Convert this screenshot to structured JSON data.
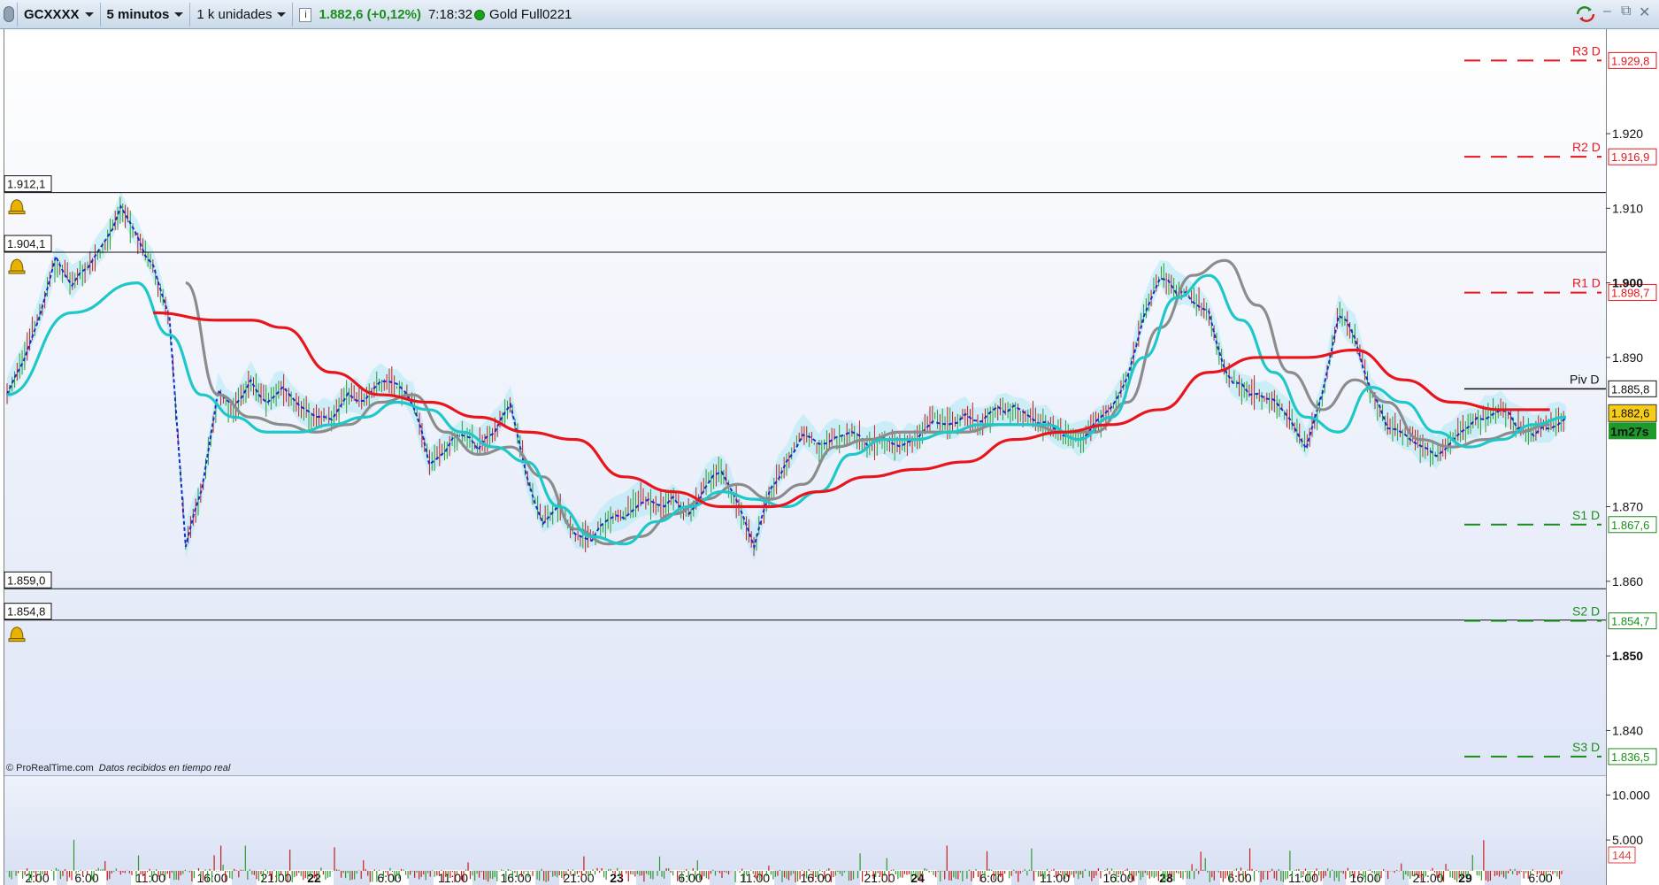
{
  "toolbar": {
    "symbol": "GCXXXX",
    "timeframe": "5 minutos",
    "units": "1 k unidades",
    "price": "1.882,6 (+0,12%)",
    "time": "7:18:32",
    "instrument": "Gold Full0221",
    "info_glyph": "i",
    "minimize": "–",
    "restore": "⧉",
    "close": "✕"
  },
  "colors": {
    "accent_up": "#1d8f1d",
    "ma_long": "#e8161c",
    "ma_short": "#1fc8c8",
    "ma_slow": "#8c8c8c",
    "cloud": "#aeeaf5",
    "resistance": "#e8161c",
    "support": "#189018"
  },
  "chart": {
    "copyright": "© ProRealTime.com",
    "feed_note": "Datos recibidos en tiempo real",
    "timer": "1m27s",
    "last_price_label": "1.882,6",
    "piv_value": "1.885,8",
    "y_ticks": [
      {
        "label": "1.920",
        "v": 1920
      },
      {
        "label": "1.910",
        "v": 1910
      },
      {
        "label": "1.900",
        "v": 1900
      },
      {
        "label": "1.890",
        "v": 1890
      },
      {
        "label": "1.870",
        "v": 1870
      },
      {
        "label": "1.860",
        "v": 1860
      },
      {
        "label": "1.850",
        "v": 1850
      },
      {
        "label": "1.840",
        "v": 1840
      }
    ],
    "price_range": [
      1834,
      1934
    ],
    "pivots": [
      {
        "name": "R3 D",
        "value": 1929.8,
        "label": "1.929,8",
        "kind": "res"
      },
      {
        "name": "R2 D",
        "value": 1916.9,
        "label": "1.916,9",
        "kind": "res"
      },
      {
        "name": "R1 D",
        "value": 1898.7,
        "label": "1.898,7",
        "kind": "res"
      },
      {
        "name": "S1 D",
        "value": 1867.6,
        "label": "1.867,6",
        "kind": "sup"
      },
      {
        "name": "S2 D",
        "value": 1854.7,
        "label": "1.854,7",
        "kind": "sup"
      },
      {
        "name": "S3 D",
        "value": 1836.5,
        "label": "1.836,5",
        "kind": "sup"
      }
    ],
    "pivot_point": {
      "name": "Piv D",
      "value": 1885.8
    },
    "alerts": [
      {
        "label": "1.912,1",
        "value": 1912.1
      },
      {
        "label": "1.904,1",
        "value": 1904.1
      },
      {
        "label": "1.859,0",
        "value": 1859.0
      },
      {
        "label": "1.854,8",
        "value": 1854.8
      }
    ],
    "volume_ticks": [
      {
        "label": "10.000",
        "v": 10000
      },
      {
        "label": "5.000",
        "v": 5000
      }
    ],
    "volume_last": "144",
    "x_ticks": [
      {
        "label": "2:00",
        "bold": false
      },
      {
        "label": "6:00",
        "bold": false
      },
      {
        "label": "11:00",
        "bold": false
      },
      {
        "label": "16:00",
        "bold": false
      },
      {
        "label": "21:00",
        "bold": false
      },
      {
        "label": "22",
        "bold": true
      },
      {
        "label": "6:00",
        "bold": false
      },
      {
        "label": "11:00",
        "bold": false
      },
      {
        "label": "16:00",
        "bold": false
      },
      {
        "label": "21:00",
        "bold": false
      },
      {
        "label": "23",
        "bold": true
      },
      {
        "label": "6:00",
        "bold": false
      },
      {
        "label": "11:00",
        "bold": false
      },
      {
        "label": "16:00",
        "bold": false
      },
      {
        "label": "21:00",
        "bold": false
      },
      {
        "label": "24",
        "bold": true
      },
      {
        "label": "6:00",
        "bold": false
      },
      {
        "label": "11:00",
        "bold": false
      },
      {
        "label": "16:00",
        "bold": false
      },
      {
        "label": "28",
        "bold": true
      },
      {
        "label": "6:00",
        "bold": false
      },
      {
        "label": "11:00",
        "bold": false
      },
      {
        "label": "16:00",
        "bold": false
      },
      {
        "label": "21:00",
        "bold": false
      },
      {
        "label": "29",
        "bold": true
      },
      {
        "label": "6:00",
        "bold": false
      }
    ],
    "price_path": [
      [
        0,
        1885
      ],
      [
        1,
        1890
      ],
      [
        2,
        1896
      ],
      [
        3,
        1903
      ],
      [
        4,
        1900
      ],
      [
        5,
        1902
      ],
      [
        6,
        1905
      ],
      [
        7,
        1910
      ],
      [
        8,
        1906
      ],
      [
        9,
        1902
      ],
      [
        10,
        1895
      ],
      [
        11,
        1865
      ],
      [
        12,
        1872
      ],
      [
        13,
        1885
      ],
      [
        14,
        1883
      ],
      [
        15,
        1887
      ],
      [
        16,
        1884
      ],
      [
        17,
        1886
      ],
      [
        18,
        1883
      ],
      [
        19,
        1882
      ],
      [
        20,
        1882
      ],
      [
        21,
        1885
      ],
      [
        22,
        1884
      ],
      [
        23,
        1887
      ],
      [
        24,
        1886
      ],
      [
        25,
        1884
      ],
      [
        26,
        1876
      ],
      [
        27,
        1878
      ],
      [
        28,
        1880
      ],
      [
        29,
        1878
      ],
      [
        30,
        1880
      ],
      [
        31,
        1884
      ],
      [
        32,
        1874
      ],
      [
        33,
        1868
      ],
      [
        34,
        1870
      ],
      [
        35,
        1866
      ],
      [
        36,
        1866
      ],
      [
        37,
        1868
      ],
      [
        38,
        1869
      ],
      [
        39,
        1871
      ],
      [
        40,
        1870
      ],
      [
        41,
        1871
      ],
      [
        42,
        1869
      ],
      [
        43,
        1873
      ],
      [
        44,
        1875
      ],
      [
        45,
        1870
      ],
      [
        46,
        1865
      ],
      [
        47,
        1872
      ],
      [
        48,
        1876
      ],
      [
        49,
        1880
      ],
      [
        50,
        1878
      ],
      [
        51,
        1879
      ],
      [
        52,
        1880
      ],
      [
        53,
        1878
      ],
      [
        54,
        1879
      ],
      [
        55,
        1878
      ],
      [
        56,
        1879
      ],
      [
        57,
        1882
      ],
      [
        58,
        1881
      ],
      [
        59,
        1882
      ],
      [
        60,
        1881
      ],
      [
        61,
        1883
      ],
      [
        62,
        1883
      ],
      [
        63,
        1882
      ],
      [
        64,
        1881
      ],
      [
        65,
        1880
      ],
      [
        66,
        1879
      ],
      [
        67,
        1881
      ],
      [
        68,
        1883
      ],
      [
        69,
        1887
      ],
      [
        70,
        1896
      ],
      [
        71,
        1901
      ],
      [
        72,
        1899
      ],
      [
        73,
        1898
      ],
      [
        74,
        1896
      ],
      [
        75,
        1888
      ],
      [
        76,
        1886
      ],
      [
        77,
        1885
      ],
      [
        78,
        1884
      ],
      [
        79,
        1882
      ],
      [
        80,
        1878
      ],
      [
        81,
        1885
      ],
      [
        82,
        1896
      ],
      [
        83,
        1893
      ],
      [
        84,
        1885
      ],
      [
        85,
        1881
      ],
      [
        86,
        1880
      ],
      [
        87,
        1878
      ],
      [
        88,
        1877
      ],
      [
        89,
        1879
      ],
      [
        90,
        1881
      ],
      [
        91,
        1882
      ],
      [
        92,
        1883
      ],
      [
        93,
        1881
      ],
      [
        94,
        1880
      ],
      [
        95,
        1881
      ],
      [
        96,
        1882
      ]
    ],
    "ma_short": [
      [
        0,
        1885
      ],
      [
        4,
        1896
      ],
      [
        8,
        1900
      ],
      [
        10,
        1893
      ],
      [
        12,
        1885
      ],
      [
        14,
        1882
      ],
      [
        16,
        1880
      ],
      [
        18,
        1880
      ],
      [
        20,
        1881
      ],
      [
        22,
        1882
      ],
      [
        24,
        1884
      ],
      [
        26,
        1883
      ],
      [
        28,
        1880
      ],
      [
        30,
        1878
      ],
      [
        32,
        1876
      ],
      [
        34,
        1870
      ],
      [
        36,
        1866
      ],
      [
        38,
        1865
      ],
      [
        40,
        1868
      ],
      [
        42,
        1870
      ],
      [
        44,
        1872
      ],
      [
        46,
        1871
      ],
      [
        48,
        1870
      ],
      [
        50,
        1872
      ],
      [
        52,
        1877
      ],
      [
        54,
        1879
      ],
      [
        56,
        1879
      ],
      [
        58,
        1880
      ],
      [
        60,
        1881
      ],
      [
        62,
        1881
      ],
      [
        64,
        1881
      ],
      [
        66,
        1879
      ],
      [
        68,
        1882
      ],
      [
        70,
        1890
      ],
      [
        72,
        1898
      ],
      [
        74,
        1901
      ],
      [
        76,
        1895
      ],
      [
        78,
        1888
      ],
      [
        80,
        1882
      ],
      [
        82,
        1880
      ],
      [
        84,
        1886
      ],
      [
        86,
        1884
      ],
      [
        88,
        1880
      ],
      [
        90,
        1878
      ],
      [
        92,
        1879
      ],
      [
        94,
        1881
      ],
      [
        96,
        1882
      ]
    ],
    "ma_slow": [
      [
        11,
        1900
      ],
      [
        13,
        1885
      ],
      [
        15,
        1882
      ],
      [
        17,
        1881
      ],
      [
        19,
        1880
      ],
      [
        21,
        1881
      ],
      [
        23,
        1884
      ],
      [
        25,
        1885
      ],
      [
        27,
        1880
      ],
      [
        29,
        1877
      ],
      [
        31,
        1878
      ],
      [
        33,
        1874
      ],
      [
        35,
        1867
      ],
      [
        37,
        1865
      ],
      [
        39,
        1866
      ],
      [
        41,
        1869
      ],
      [
        43,
        1871
      ],
      [
        45,
        1873
      ],
      [
        47,
        1871
      ],
      [
        49,
        1873
      ],
      [
        51,
        1878
      ],
      [
        53,
        1879
      ],
      [
        55,
        1880
      ],
      [
        57,
        1880
      ],
      [
        59,
        1880
      ],
      [
        61,
        1881
      ],
      [
        63,
        1881
      ],
      [
        65,
        1880
      ],
      [
        67,
        1880
      ],
      [
        69,
        1884
      ],
      [
        71,
        1894
      ],
      [
        73,
        1901
      ],
      [
        75,
        1903
      ],
      [
        77,
        1897
      ],
      [
        79,
        1888
      ],
      [
        81,
        1883
      ],
      [
        83,
        1887
      ],
      [
        85,
        1884
      ],
      [
        87,
        1879
      ],
      [
        89,
        1878
      ],
      [
        91,
        1879
      ],
      [
        93,
        1880
      ],
      [
        95,
        1881
      ]
    ],
    "ma_long": [
      [
        9,
        1896
      ],
      [
        13,
        1895
      ],
      [
        15,
        1895
      ],
      [
        17,
        1894
      ],
      [
        20,
        1888
      ],
      [
        23,
        1885
      ],
      [
        26,
        1884
      ],
      [
        29,
        1882
      ],
      [
        32,
        1880
      ],
      [
        35,
        1879
      ],
      [
        38,
        1874
      ],
      [
        41,
        1872
      ],
      [
        44,
        1870
      ],
      [
        47,
        1870
      ],
      [
        50,
        1872
      ],
      [
        53,
        1874
      ],
      [
        56,
        1875
      ],
      [
        59,
        1876
      ],
      [
        62,
        1879
      ],
      [
        65,
        1880
      ],
      [
        68,
        1881
      ],
      [
        71,
        1883
      ],
      [
        74,
        1888
      ],
      [
        77,
        1890
      ],
      [
        80,
        1890
      ],
      [
        83,
        1891
      ],
      [
        86,
        1887
      ],
      [
        89,
        1884
      ],
      [
        92,
        1883
      ],
      [
        95,
        1883
      ]
    ]
  }
}
